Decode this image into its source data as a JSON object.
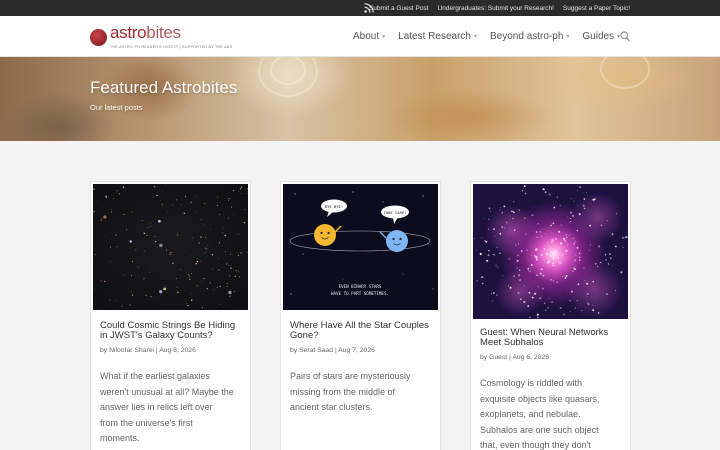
{
  "topbar": {
    "rss_icon": "rss-icon",
    "links": [
      "Submit a Guest Post",
      "Undergraduates: Submit your Research!",
      "Suggest a Paper Topic!"
    ]
  },
  "header": {
    "logo": {
      "word_main": "astro",
      "word_light": "bites",
      "tagline": "THE ASTRO-PH READER'S DIGEST  |  SUPPORTED BY THE AAS"
    },
    "nav": [
      {
        "label": "About",
        "caret": "▾"
      },
      {
        "label": "Latest Research",
        "caret": "▾"
      },
      {
        "label": "Beyond astro-ph",
        "caret": "▾"
      },
      {
        "label": "Guides",
        "caret": "▾"
      }
    ],
    "search_icon": "search-icon"
  },
  "hero": {
    "title": "Featured Astrobites",
    "subtitle": "Our latest posts"
  },
  "posts": [
    {
      "title_lines": [
        "Could Cosmic Strings Be Hiding",
        "in JWST's Galaxy Counts?"
      ],
      "meta": "by Niloofar Sharei | Aug 8, 2026",
      "excerpt_lines": [
        "What if the earliest galaxies",
        "weren't unusual at all? Maybe the",
        "answer lies in relics left over",
        "from the universe's first",
        "moments."
      ],
      "image": "jwst-deep-field"
    },
    {
      "title_lines": [
        "Where Have All the Star Couples",
        "Gone?"
      ],
      "meta": "by Serat Saad | Aug 7, 2026",
      "excerpt_lines": [
        "Pairs of stars are mysteriously",
        "missing from the middle of",
        "ancient star clusters."
      ],
      "image": "binary-stars-cartoon",
      "cartoon_text": {
        "left_bubble": "BYE BYE!",
        "right_bubble": "TAKE CARE!",
        "caption_lines": [
          "EVEN BINARY STARS",
          "HAVE TO PART SOMETIMES."
        ]
      }
    },
    {
      "title_lines": [
        "Guest: When Neural Networks",
        "Meet Subhalos"
      ],
      "meta": "by Guest | Aug 6, 2026",
      "excerpt_lines": [
        "Cosmology is riddled with",
        "exquisite objects like quasars,",
        "exoplanets, and nebulae.",
        "Subhalos are one such object",
        "that, even though they don't"
      ],
      "image": "dark-matter-simulation"
    }
  ]
}
